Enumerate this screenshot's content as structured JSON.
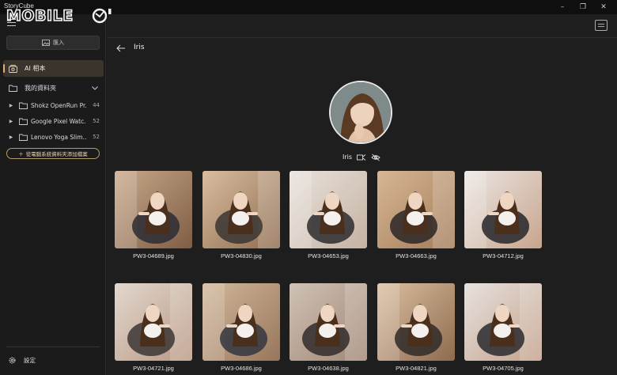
{
  "window": {
    "title": "StoryCube",
    "controls": [
      "–",
      "❐",
      "✕"
    ],
    "logo_text": "MOBILE01"
  },
  "sidebar": {
    "import_label": "匯入",
    "ai_album_label": "AI 相本",
    "my_folders_label": "我的資料夾",
    "folders": [
      {
        "name": "Shokz OpenRun Pr...",
        "count": "44"
      },
      {
        "name": "Google Pixel Watc...",
        "count": "52"
      },
      {
        "name": "Lenovo Yoga Slim...",
        "count": "52"
      }
    ],
    "add_folder_label": "從電腦系統資料夾添加檔案",
    "settings_label": "設定"
  },
  "main": {
    "title": "Iris",
    "person_name": "Iris"
  },
  "photos": [
    {
      "file": "PW3-04689.jpg",
      "colors": [
        "#c9a98a",
        "#7e5d44",
        "#2c2c34"
      ]
    },
    {
      "file": "PW3-04830.jpg",
      "colors": [
        "#d8bea0",
        "#8f6b4e",
        "#3a3532"
      ]
    },
    {
      "file": "PW3-04653.jpg",
      "colors": [
        "#e8e2dc",
        "#c5b2a2",
        "#2d2b2e"
      ]
    },
    {
      "file": "PW3-04663.jpg",
      "colors": [
        "#d7b794",
        "#a47c59",
        "#2b2626"
      ]
    },
    {
      "file": "PW3-04712.jpg",
      "colors": [
        "#ece7e3",
        "#c7a48d",
        "#262629"
      ]
    },
    {
      "file": "PW3-04721.jpg",
      "colors": [
        "#e2d8ce",
        "#b99883",
        "#3b3634"
      ]
    },
    {
      "file": "PW3-04686.jpg",
      "colors": [
        "#d2b89b",
        "#98765c",
        "#333640"
      ]
    },
    {
      "file": "PW3-04638.jpg",
      "colors": [
        "#cfc2b6",
        "#a18674",
        "#302c2c"
      ]
    },
    {
      "file": "PW3-04821.jpg",
      "colors": [
        "#dcc0a2",
        "#8e6a4e",
        "#2f2a28"
      ]
    },
    {
      "file": "PW3-04705.jpg",
      "colors": [
        "#e7e3df",
        "#c3a08a",
        "#2a2a2e"
      ]
    }
  ]
}
